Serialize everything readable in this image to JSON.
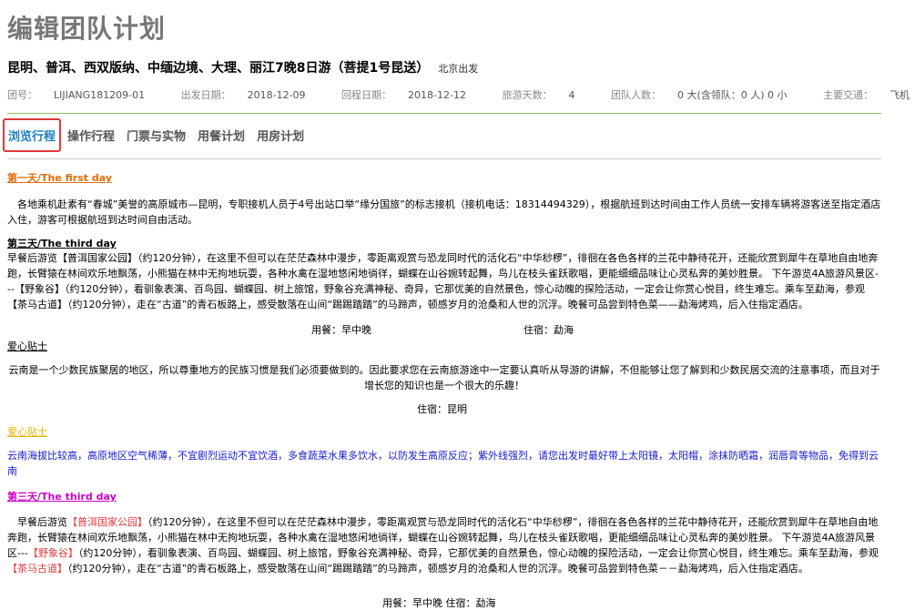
{
  "page": {
    "title": "编辑团队计划",
    "tour_name": "昆明、普洱、西双版纳、中缅边境、大理、丽江7晚8日游（菩提1号昆送）",
    "departure": "北京出发"
  },
  "meta": {
    "group_label": "团号：",
    "group_value": "LIJIANG181209-01",
    "start_label": "出发日期：",
    "start_value": "2018-12-09",
    "return_label": "回程日期：",
    "return_value": "2018-12-12",
    "days_label": "旅游天数：",
    "days_value": "4",
    "people_label": "团队人数：",
    "people_value": "0 大(含领队：0 人) 0 小",
    "transport_label": "主要交通：",
    "transport_value": "飞机"
  },
  "tabs": [
    {
      "label": "浏览行程"
    },
    {
      "label": "操作行程"
    },
    {
      "label": "门票与实物"
    },
    {
      "label": "用餐计划"
    },
    {
      "label": "用房计划"
    }
  ],
  "content": {
    "day1_heading": "第一天/The first day",
    "day1_text": "　各地乘机赴素有“春城”美誉的高原城市—昆明，专职接机人员于4号出站口举“缘分国旅”的标志接机（接机电话：18314494329），根据航班到达时间由工作人员统一安排车辆将游客送至指定酒店入住，游客可根据航班到达时间自由活动。",
    "day3a_heading": "第三天/The third day",
    "day3a_text": "早餐后游览【普洱国家公园】（约120分钟），在这里不但可以在茫茫森林中漫步，零距离观赏与恐龙同时代的活化石“中华桫椤”，徘徊在各色各样的兰花中静待花开，还能欣赏到犀牛在草地自由地奔跑，长臂猿在林间欢乐地飘荡，小熊猫在林中无拘地玩耍，各种水禽在湿地悠闲地徜徉，蝴蝶在山谷婉转起舞，鸟儿在枝头雀跃歌唱，更能细细品味让心灵私奔的美妙胜景。 下午游览4A旅游风景区---【野象谷】（约120分钟），看驯象表演、百鸟园、蝴蝶园、树上旅馆，野象谷充满神秘、奇异，它那优美的自然景色，惊心动魄的探险活动，一定会让你赏心悦目，终生难忘。乘车至勐海，参观【茶马古道】（约120分钟），走在“古道”的青石板路上，感受散落在山间“踢踢踏踏”的马蹄声，顿感岁月的沧桑和人世的沉浮。晚餐可品尝到特色菜——勐海烤鸡，后入住指定酒店。",
    "day3a_meal": "用餐：早中晚",
    "day3a_stay": "住宿：勐海",
    "tips1_heading": "爱心贴士",
    "tips1_text": "云南是一个少数民族聚居的地区，所以尊重地方的民族习惯是我们必须要做到的。因此要求您在云南旅游途中一定要认真听从导游的讲解，不但能够让您了解到和少数民居交流的注意事项，而且对于增长您的知识也是一个很大的乐趣！",
    "tips1_stay": "住宿：昆明",
    "tips2_heading": "爱心贴士",
    "tips2_text": "云南海拔比较高，高原地区空气稀薄，不宜剧烈运动不宜饮酒，多食蔬菜水果多饮水，以防发生高原反应；紫外线强烈，请您出发时最好带上太阳镜，太阳帽，涂抹防晒霜，润唇膏等物品，免得到云南",
    "day3b_heading": "第三天/The third day",
    "day3b_t1": "　早餐后游览",
    "day3b_r1": "【普洱国家公园】",
    "day3b_t2": "（约120分钟），在这里不但可以在茫茫森林中漫步，零距离观赏与恐龙同时代的活化石“中华桫椤”，徘徊在各色各样的兰花中静待花开，还能欣赏到犀牛在草地自由地奔跑，长臂猿在林间欢乐地飘荡，小熊猫在林中无拘地玩耍，各种水禽在湿地悠闲地徜徉，蝴蝶在山谷婉转起舞，鸟儿在枝头雀跃歌唱，更能细细品味让心灵私奔的美妙胜景。 下午游览4A旅游风景区---",
    "day3b_r2": "【野象谷】",
    "day3b_t3": "（约120分钟），看驯象表演、百鸟园、蝴蝶园、树上旅馆，野象谷充满神秘、奇异，它那优美的自然景色，惊心动魄的探险活动，一定会让你赏心悦目，终生难忘。乘车至勐海，参观",
    "day3b_r3": "【茶马古道】",
    "day3b_t4": "（约120分钟），走在“古道”的青石板路上，感受散落在山间“踢踢踏踏”的马蹄声，顿感岁月的沧桑和人世的沉浮。晚餐可品尝到特色菜－－勐海烤鸡，后入住指定酒店。",
    "day3b_mealstay": "用餐：早中晚 住宿：勐海"
  },
  "colors": {
    "tab_active": "#1c7fbf",
    "tab_active_border": "#e0393a",
    "divider": "#8fbc5a",
    "heading_orange": "#e36c0a",
    "heading_magenta": "#cc00cc",
    "tips_blue": "#1a1ad0"
  }
}
